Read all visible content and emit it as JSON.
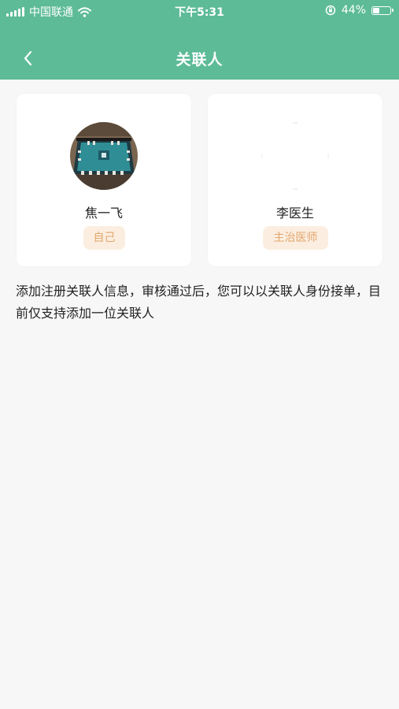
{
  "status_bar": {
    "carrier": "中国联通",
    "time": "下午5:31",
    "battery": "44%",
    "battery_level": 0.44,
    "icons": [
      "signal-icon",
      "wifi-icon",
      "rotation-lock-icon",
      "battery-icon"
    ]
  },
  "nav": {
    "title": "关联人",
    "back_icon": "chevron-left-icon"
  },
  "cards": [
    {
      "name": "焦一飞",
      "tag": "自己"
    },
    {
      "name": "李医生",
      "tag": "主治医师"
    }
  ],
  "description": "添加注册关联人信息，审核通过后，您可以以关联人身份接单，目前仅支持添加一位关联人",
  "colors": {
    "header": "#5dbb98",
    "background": "#f7f7f7",
    "badge_bg": "#fbeee0",
    "badge_text": "#e3a76e"
  }
}
